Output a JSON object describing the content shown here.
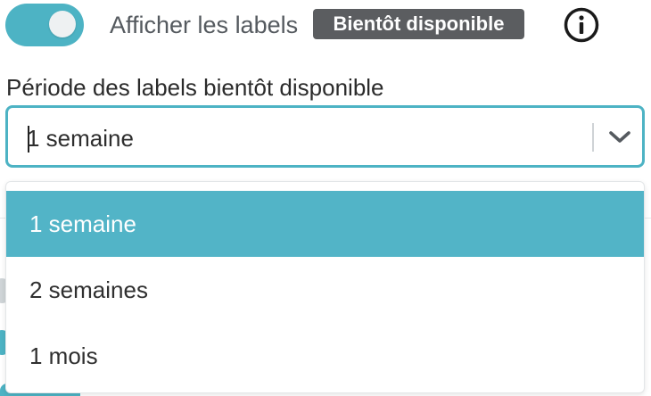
{
  "toggle": {
    "state": "on",
    "label": "Afficher les labels",
    "badge": "Bientôt disponible",
    "info_icon": "info-circle-icon"
  },
  "select": {
    "label": "Période des labels bientôt disponible",
    "value": "1 semaine",
    "arrow_icon": "chevron-down-icon",
    "open": true
  },
  "menu": {
    "options": [
      {
        "label": "1 semaine",
        "selected": true
      },
      {
        "label": "2 semaines",
        "selected": false
      },
      {
        "label": "1 mois",
        "selected": false
      }
    ]
  },
  "colors": {
    "accent": "#4db3c4",
    "badge_bg": "#5b5d60",
    "selected_option_bg": "#52b4c7"
  }
}
